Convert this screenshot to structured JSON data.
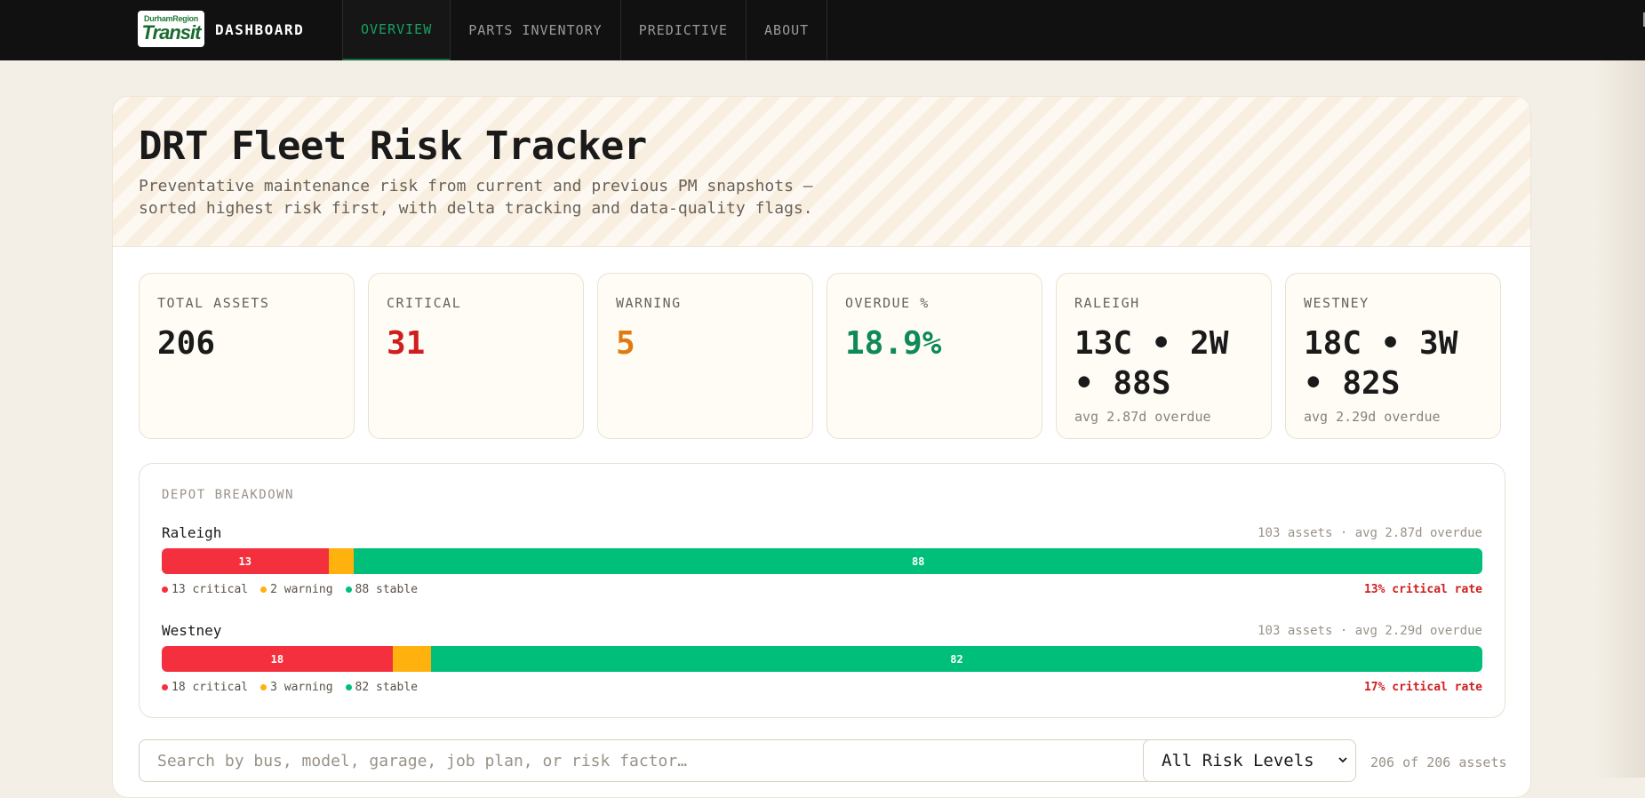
{
  "brand": {
    "logo_small": "DurhamRegion",
    "logo_big": "Transit",
    "title": "DASHBOARD"
  },
  "nav": [
    {
      "label": "OVERVIEW",
      "active": true
    },
    {
      "label": "PARTS INVENTORY",
      "active": false
    },
    {
      "label": "PREDICTIVE",
      "active": false
    },
    {
      "label": "ABOUT",
      "active": false
    }
  ],
  "hero": {
    "title": "DRT Fleet Risk Tracker",
    "subtitle": "Preventative maintenance risk from current and previous PM snapshots — sorted highest risk first, with delta tracking and data-quality flags."
  },
  "cards": {
    "total": {
      "label": "TOTAL ASSETS",
      "value": "206"
    },
    "critical": {
      "label": "CRITICAL",
      "value": "31"
    },
    "warning": {
      "label": "WARNING",
      "value": "5"
    },
    "overdue": {
      "label": "OVERDUE %",
      "value": "18.9%"
    },
    "raleigh": {
      "label": "RALEIGH",
      "value": "13C • 2W • 88S",
      "sub": "avg 2.87d overdue"
    },
    "westney": {
      "label": "WESTNEY",
      "value": "18C • 3W • 82S",
      "sub": "avg 2.29d overdue"
    }
  },
  "depot": {
    "title": "DEPOT BREAKDOWN",
    "rows": [
      {
        "name": "Raleigh",
        "meta": "103 assets · avg 2.87d overdue",
        "critical": 13,
        "warning": 2,
        "stable": 88,
        "critical_label": "13",
        "stable_label": "88",
        "legend_critical": "13 critical",
        "legend_warning": "2 warning",
        "legend_stable": "88 stable",
        "rate": "13% critical rate"
      },
      {
        "name": "Westney",
        "meta": "103 assets · avg 2.29d overdue",
        "critical": 18,
        "warning": 3,
        "stable": 82,
        "critical_label": "18",
        "stable_label": "82",
        "legend_critical": "18 critical",
        "legend_warning": "3 warning",
        "legend_stable": "82 stable",
        "rate": "17% critical rate"
      }
    ]
  },
  "filters": {
    "search_placeholder": "Search by bus, model, garage, job plan, or risk factor…",
    "risk_select": "All Risk Levels",
    "count": "206 of 206 assets"
  },
  "colors": {
    "critical": "#f4303e",
    "warning": "#ffb20e",
    "stable": "#00bf7a",
    "nav_active": "#16a060"
  }
}
